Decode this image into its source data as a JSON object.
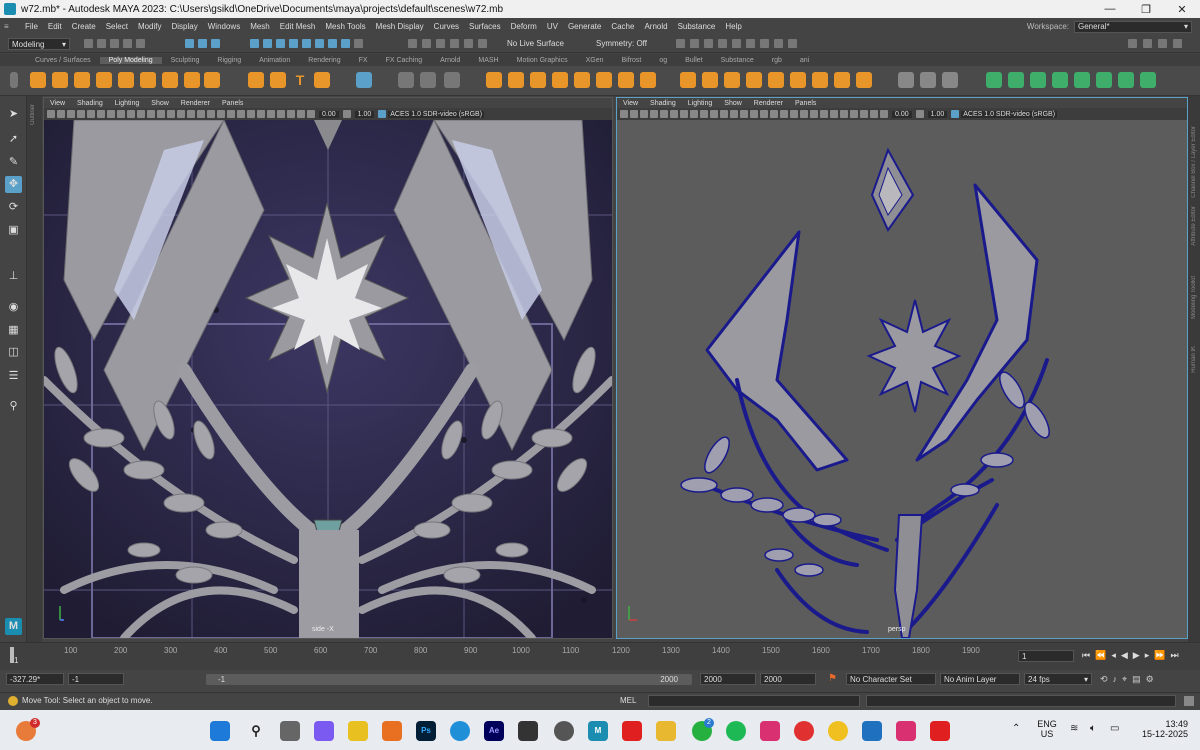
{
  "window": {
    "title": "w72.mb* - Autodesk MAYA 2023: C:\\Users\\gsikd\\OneDrive\\Documents\\maya\\projects\\default\\scenes\\w72.mb",
    "minimize": "—",
    "restore": "❐",
    "close": "✕"
  },
  "menu": [
    "File",
    "Edit",
    "Create",
    "Select",
    "Modify",
    "Display",
    "Windows",
    "Mesh",
    "Edit Mesh",
    "Mesh Tools",
    "Mesh Display",
    "Curves",
    "Surfaces",
    "Deform",
    "UV",
    "Generate",
    "Cache",
    "Arnold",
    "Substance",
    "Help"
  ],
  "workspace": {
    "label": "Workspace:",
    "value": "General*"
  },
  "statusline": {
    "menuset": "Modeling",
    "live_surface": "No Live Surface",
    "symmetry": "Symmetry: Off"
  },
  "shelf_tabs": [
    "Curves / Surfaces",
    "Poly Modeling",
    "Sculpting",
    "Rigging",
    "Animation",
    "Rendering",
    "FX",
    "FX Caching",
    "Arnold",
    "MASH",
    "Motion Graphics",
    "XGen",
    "Bifrost",
    "og",
    "Bullet",
    "Substance",
    "rgb",
    "ani"
  ],
  "shelf_active": "Poly Modeling",
  "side_labels": {
    "outliner": "Outliner",
    "channel_box": "Channel Box / Layer Editor",
    "attribute_editor": "Attribute Editor",
    "modeling_toolkit": "Modeling Toolkit",
    "human_ik": "Human IK"
  },
  "viewport_left": {
    "menu": [
      "View",
      "Shading",
      "Lighting",
      "Show",
      "Renderer",
      "Panels"
    ],
    "exposure": "0.00",
    "gamma": "1.00",
    "colorspace": "ACES 1.0 SDR-video (sRGB)",
    "camera": "side -X"
  },
  "viewport_right": {
    "menu": [
      "View",
      "Shading",
      "Lighting",
      "Show",
      "Renderer",
      "Panels"
    ],
    "exposure": "0.00",
    "gamma": "1.00",
    "colorspace": "ACES 1.0 SDR-video (sRGB)",
    "camera": "persp"
  },
  "timeline": {
    "ticks": [
      "1",
      "100",
      "200",
      "300",
      "400",
      "500",
      "600",
      "700",
      "800",
      "900",
      "1000",
      "1100",
      "1200",
      "1300",
      "1400",
      "1500",
      "1600",
      "1700",
      "1800",
      "1900"
    ],
    "current_frame": "1"
  },
  "range": {
    "field1": "-327.29*",
    "field2": "-1",
    "slider_start": "-1",
    "slider_end": "2000",
    "end1": "2000",
    "end2": "2000",
    "character_set": "No Character Set",
    "anim_layer": "No Anim Layer",
    "fps": "24 fps"
  },
  "helpline": {
    "text": "Move Tool: Select an object to move.",
    "mel": "MEL"
  },
  "taskbar": {
    "lang1": "ENG",
    "lang2": "US",
    "time": "13:49",
    "date": "15-12-2025",
    "badge1": "3",
    "badge2": "2"
  }
}
